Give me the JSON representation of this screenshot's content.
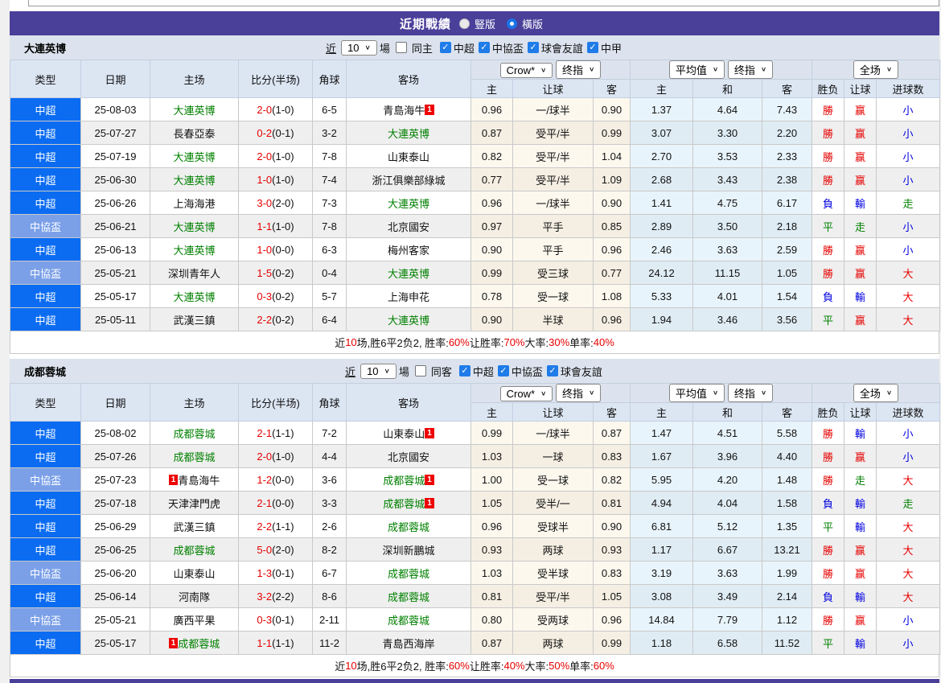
{
  "colors": {
    "purple": "#4a3f99",
    "league_colors": {
      "中超": "#0b6cf2",
      "中協盃": "#7ba0e8"
    },
    "focus_team_green": "#008000",
    "score_red": "#e60000",
    "result_colors": {
      "勝": "#e60000",
      "赢": "#e60000",
      "大": "#e60000",
      "負": "#0000e0",
      "輸": "#0000e0",
      "小": "#0000e0",
      "平": "#008000",
      "走": "#008000"
    }
  },
  "title_bar": {
    "title": "近期戰績",
    "radios": [
      {
        "label": "豎版",
        "selected": false
      },
      {
        "label": "橫版",
        "selected": true
      }
    ]
  },
  "sections": [
    {
      "team": "大連英博",
      "controls": {
        "near": "近",
        "count": "10",
        "unit": "場",
        "same": {
          "label": "同主",
          "checked": false
        },
        "leagues": [
          {
            "label": "中超",
            "checked": true
          },
          {
            "label": "中協盃",
            "checked": true
          },
          {
            "label": "球會友誼",
            "checked": true
          },
          {
            "label": "中甲",
            "checked": true
          }
        ]
      },
      "selects": {
        "odds": "Crow*",
        "odds2": "终指",
        "avg": "平均值",
        "avg2": "终指",
        "scope": "全场"
      },
      "columns": [
        "类型",
        "日期",
        "主场",
        "比分(半场)",
        "角球",
        "客场"
      ],
      "sub_columns": [
        "主",
        "让球",
        "客",
        "主",
        "和",
        "客",
        "胜负",
        "让球",
        "进球数"
      ],
      "rows": [
        {
          "lg": "中超",
          "d": "25-08-03",
          "h": "大連英博",
          "hF": 1,
          "s": "2-0",
          "sh": "(1-0)",
          "cn": "6-5",
          "a": "青島海牛",
          "ab2": "1",
          "o": [
            "0.96",
            "一/球半",
            "0.90",
            "1.37",
            "4.64",
            "7.43"
          ],
          "r": [
            "勝",
            "赢",
            "小"
          ]
        },
        {
          "lg": "中超",
          "d": "25-07-27",
          "h": "長春亞泰",
          "s": "0-2",
          "sh": "(0-1)",
          "cn": "3-2",
          "a": "大連英博",
          "aF": 1,
          "o": [
            "0.87",
            "受平/半",
            "0.99",
            "3.07",
            "3.30",
            "2.20"
          ],
          "r": [
            "勝",
            "赢",
            "小"
          ]
        },
        {
          "lg": "中超",
          "d": "25-07-19",
          "h": "大連英博",
          "hF": 1,
          "s": "2-0",
          "sh": "(1-0)",
          "cn": "7-8",
          "a": "山東泰山",
          "o": [
            "0.82",
            "受平/半",
            "1.04",
            "2.70",
            "3.53",
            "2.33"
          ],
          "r": [
            "勝",
            "赢",
            "小"
          ]
        },
        {
          "lg": "中超",
          "d": "25-06-30",
          "h": "大連英博",
          "hF": 1,
          "s": "1-0",
          "sh": "(1-0)",
          "cn": "7-4",
          "a": "浙江俱樂部綠城",
          "o": [
            "0.77",
            "受平/半",
            "1.09",
            "2.68",
            "3.43",
            "2.38"
          ],
          "r": [
            "勝",
            "赢",
            "小"
          ]
        },
        {
          "lg": "中超",
          "d": "25-06-26",
          "h": "上海海港",
          "s": "3-0",
          "sh": "(2-0)",
          "cn": "7-3",
          "a": "大連英博",
          "aF": 1,
          "o": [
            "0.96",
            "一/球半",
            "0.90",
            "1.41",
            "4.75",
            "6.17"
          ],
          "r": [
            "負",
            "輸",
            "走"
          ]
        },
        {
          "lg": "中協盃",
          "d": "25-06-21",
          "h": "大連英博",
          "hF": 1,
          "s": "1-1",
          "sh": "(1-0)",
          "cn": "7-8",
          "a": "北京國安",
          "o": [
            "0.97",
            "平手",
            "0.85",
            "2.89",
            "3.50",
            "2.18"
          ],
          "r": [
            "平",
            "走",
            "小"
          ]
        },
        {
          "lg": "中超",
          "d": "25-06-13",
          "h": "大連英博",
          "hF": 1,
          "s": "1-0",
          "sh": "(0-0)",
          "cn": "6-3",
          "a": "梅州客家",
          "o": [
            "0.90",
            "平手",
            "0.96",
            "2.46",
            "3.63",
            "2.59"
          ],
          "r": [
            "勝",
            "赢",
            "小"
          ]
        },
        {
          "lg": "中協盃",
          "d": "25-05-21",
          "h": "深圳青年人",
          "s": "1-5",
          "sh": "(0-2)",
          "cn": "0-4",
          "a": "大連英博",
          "aF": 1,
          "o": [
            "0.99",
            "受三球",
            "0.77",
            "24.12",
            "11.15",
            "1.05"
          ],
          "r": [
            "勝",
            "赢",
            "大"
          ]
        },
        {
          "lg": "中超",
          "d": "25-05-17",
          "h": "大連英博",
          "hF": 1,
          "s": "0-3",
          "sh": "(0-2)",
          "cn": "5-7",
          "a": "上海申花",
          "o": [
            "0.78",
            "受一球",
            "1.08",
            "5.33",
            "4.01",
            "1.54"
          ],
          "r": [
            "負",
            "輸",
            "大"
          ]
        },
        {
          "lg": "中超",
          "d": "25-05-11",
          "h": "武漢三鎮",
          "s": "2-2",
          "sh": "(0-2)",
          "cn": "6-4",
          "a": "大連英博",
          "aF": 1,
          "o": [
            "0.90",
            "半球",
            "0.96",
            "1.94",
            "3.46",
            "3.56"
          ],
          "r": [
            "平",
            "赢",
            "大"
          ]
        }
      ],
      "summary": [
        [
          "近",
          "k"
        ],
        [
          "10",
          "r"
        ],
        [
          "场,胜6平2负2, 胜率:",
          "k"
        ],
        [
          "60%",
          "r"
        ],
        [
          " 让胜率:",
          "k"
        ],
        [
          "70%",
          "r"
        ],
        [
          " 大率:",
          "k"
        ],
        [
          "30%",
          "r"
        ],
        [
          " 单率:",
          "k"
        ],
        [
          "40%",
          "r"
        ]
      ]
    },
    {
      "team": "成都蓉城",
      "controls": {
        "near": "近",
        "count": "10",
        "unit": "場",
        "same": {
          "label": "同客",
          "checked": false
        },
        "leagues": [
          {
            "label": "中超",
            "checked": true
          },
          {
            "label": "中協盃",
            "checked": true
          },
          {
            "label": "球會友誼",
            "checked": true
          }
        ]
      },
      "selects": {
        "odds": "Crow*",
        "odds2": "终指",
        "avg": "平均值",
        "avg2": "终指",
        "scope": "全场"
      },
      "columns": [
        "类型",
        "日期",
        "主场",
        "比分(半场)",
        "角球",
        "客场"
      ],
      "sub_columns": [
        "主",
        "让球",
        "客",
        "主",
        "和",
        "客",
        "胜负",
        "让球",
        "进球数"
      ],
      "rows": [
        {
          "lg": "中超",
          "d": "25-08-02",
          "h": "成都蓉城",
          "hF": 1,
          "s": "2-1",
          "sh": "(1-1)",
          "cn": "7-2",
          "a": "山東泰山",
          "ab2": "1",
          "o": [
            "0.99",
            "一/球半",
            "0.87",
            "1.47",
            "4.51",
            "5.58"
          ],
          "r": [
            "勝",
            "輸",
            "小"
          ]
        },
        {
          "lg": "中超",
          "d": "25-07-26",
          "h": "成都蓉城",
          "hF": 1,
          "s": "2-0",
          "sh": "(1-0)",
          "cn": "4-4",
          "a": "北京國安",
          "o": [
            "1.03",
            "一球",
            "0.83",
            "1.67",
            "3.96",
            "4.40"
          ],
          "r": [
            "勝",
            "赢",
            "小"
          ]
        },
        {
          "lg": "中協盃",
          "d": "25-07-23",
          "hb1": "1",
          "h": "青島海牛",
          "s": "1-2",
          "sh": "(0-0)",
          "cn": "3-6",
          "a": "成都蓉城",
          "aF": 1,
          "ab2": "1",
          "o": [
            "1.00",
            "受一球",
            "0.82",
            "5.95",
            "4.20",
            "1.48"
          ],
          "r": [
            "勝",
            "走",
            "大"
          ]
        },
        {
          "lg": "中超",
          "d": "25-07-18",
          "h": "天津津門虎",
          "s": "2-1",
          "sh": "(0-0)",
          "cn": "3-3",
          "a": "成都蓉城",
          "aF": 1,
          "ab2": "1",
          "o": [
            "1.05",
            "受半/一",
            "0.81",
            "4.94",
            "4.04",
            "1.58"
          ],
          "r": [
            "負",
            "輸",
            "走"
          ]
        },
        {
          "lg": "中超",
          "d": "25-06-29",
          "h": "武漢三鎮",
          "s": "2-2",
          "sh": "(1-1)",
          "cn": "2-6",
          "a": "成都蓉城",
          "aF": 1,
          "o": [
            "0.96",
            "受球半",
            "0.90",
            "6.81",
            "5.12",
            "1.35"
          ],
          "r": [
            "平",
            "輸",
            "大"
          ]
        },
        {
          "lg": "中超",
          "d": "25-06-25",
          "h": "成都蓉城",
          "hF": 1,
          "s": "5-0",
          "sh": "(2-0)",
          "cn": "8-2",
          "a": "深圳新鵬城",
          "o": [
            "0.93",
            "两球",
            "0.93",
            "1.17",
            "6.67",
            "13.21"
          ],
          "r": [
            "勝",
            "赢",
            "大"
          ]
        },
        {
          "lg": "中協盃",
          "d": "25-06-20",
          "h": "山東泰山",
          "s": "1-3",
          "sh": "(0-1)",
          "cn": "6-7",
          "a": "成都蓉城",
          "aF": 1,
          "o": [
            "1.03",
            "受半球",
            "0.83",
            "3.19",
            "3.63",
            "1.99"
          ],
          "r": [
            "勝",
            "赢",
            "大"
          ]
        },
        {
          "lg": "中超",
          "d": "25-06-14",
          "h": "河南隊",
          "s": "3-2",
          "sh": "(2-2)",
          "cn": "8-6",
          "a": "成都蓉城",
          "aF": 1,
          "o": [
            "0.81",
            "受平/半",
            "1.05",
            "3.08",
            "3.49",
            "2.14"
          ],
          "r": [
            "負",
            "輸",
            "大"
          ]
        },
        {
          "lg": "中協盃",
          "d": "25-05-21",
          "h": "廣西平果",
          "s": "0-3",
          "sh": "(0-1)",
          "cn": "2-11",
          "a": "成都蓉城",
          "aF": 1,
          "o": [
            "0.80",
            "受两球",
            "0.96",
            "14.84",
            "7.79",
            "1.12"
          ],
          "r": [
            "勝",
            "赢",
            "小"
          ]
        },
        {
          "lg": "中超",
          "d": "25-05-17",
          "hb1": "1",
          "h": "成都蓉城",
          "hF": 1,
          "s": "1-1",
          "sh": "(1-1)",
          "cn": "11-2",
          "a": "青島西海岸",
          "o": [
            "0.87",
            "两球",
            "0.99",
            "1.18",
            "6.58",
            "11.52"
          ],
          "r": [
            "平",
            "輸",
            "小"
          ]
        }
      ],
      "summary": [
        [
          "近",
          "k"
        ],
        [
          "10",
          "r"
        ],
        [
          "场,胜6平2负2, 胜率:",
          "k"
        ],
        [
          "60%",
          "r"
        ],
        [
          " 让胜率:",
          "k"
        ],
        [
          "40%",
          "r"
        ],
        [
          " 大率:",
          "k"
        ],
        [
          "50%",
          "r"
        ],
        [
          " 单率:",
          "k"
        ],
        [
          "60%",
          "r"
        ]
      ]
    }
  ]
}
